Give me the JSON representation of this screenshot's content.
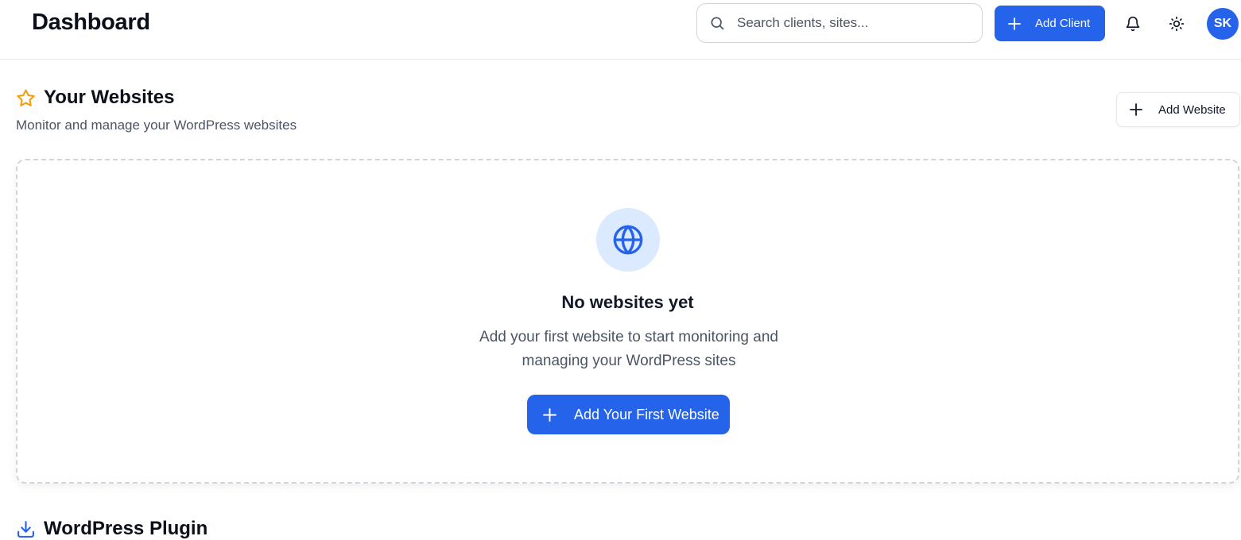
{
  "header": {
    "title": "Dashboard",
    "search_placeholder": "Search clients, sites...",
    "add_client_label": "Add Client",
    "avatar_initials": "SK"
  },
  "websites": {
    "title": "Your Websites",
    "subtitle": "Monitor and manage your WordPress websites",
    "add_website_label": "Add Website",
    "empty_state": {
      "title": "No websites yet",
      "text": "Add your first website to start monitoring and managing your WordPress sites",
      "button_label": "Add Your First Website"
    }
  },
  "plugin_section": {
    "title": "WordPress Plugin"
  },
  "colors": {
    "accent": "#2563eb",
    "star": "#f59e0b",
    "globe_bg": "#dbeafe"
  },
  "icons": [
    "search-icon",
    "plus-icon",
    "bell-icon",
    "sun-icon",
    "star-icon",
    "globe-icon",
    "download-icon"
  ]
}
